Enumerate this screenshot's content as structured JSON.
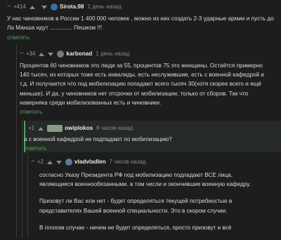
{
  "c1": {
    "score": "+414",
    "user": "Sirota.98",
    "time": "1 день назад",
    "text": "У нас чиновников в России 1 400 000 человек , можно из них создать 2-3 ударные армии и пусть до Ла Манша идут .............. Пешком !!!",
    "reply": "ответить",
    "avatar_color": "#3a6ea5"
  },
  "c2": {
    "score": "+34",
    "user": "karbonad",
    "time": "1 день назад",
    "text": "Процентов 60 чиновников это люди за 55, процентов 75 это женщины. Остаётся примерно 140 тысяч, из которых тоже есть инвалиды, есть неслужившие, есть с военной кафедрой и т.д. И получается что под мобилизацию попадают всего тысяч 30(хотя скорее всего и ещё меньше). И да, у чиновников нет отсрочки от мобилизации, только от сборов. Так что наверняка среди мобилизованных есть и чиновники.",
    "reply": "ответить",
    "avatar_color": "#7a7a7a"
  },
  "c3": {
    "score": "+1",
    "user": "owiplokos",
    "time": "8 часов назад",
    "text": "а с военной кафедрой не подпадают по мобилизацию?",
    "reply": "ответить",
    "avatar_color": "#8a9a8a"
  },
  "c4": {
    "score": "+2",
    "user": "vladvladlen",
    "time": "7 часов назад",
    "paragraphs": [
      "согласно Указу Президента РФ под мобилизацию подпадают ВСЕ лица, являющиеся военнообязанными. в том числи и окончившие военную кафедру.",
      "Призовут ли Вас или нет  - будет определяться текущей потребностью в представителях Вашей военной специальности.  Это в скором случае.",
      "В плохом случае  - ничем не будет определяться, просто призовут и всё"
    ],
    "avatar_color": "#5a7a9a"
  },
  "colors": {
    "background": "#1d1d1d",
    "reply": "#4fa35a",
    "text": "#dcdcdc",
    "meta": "#8a8a8a"
  }
}
